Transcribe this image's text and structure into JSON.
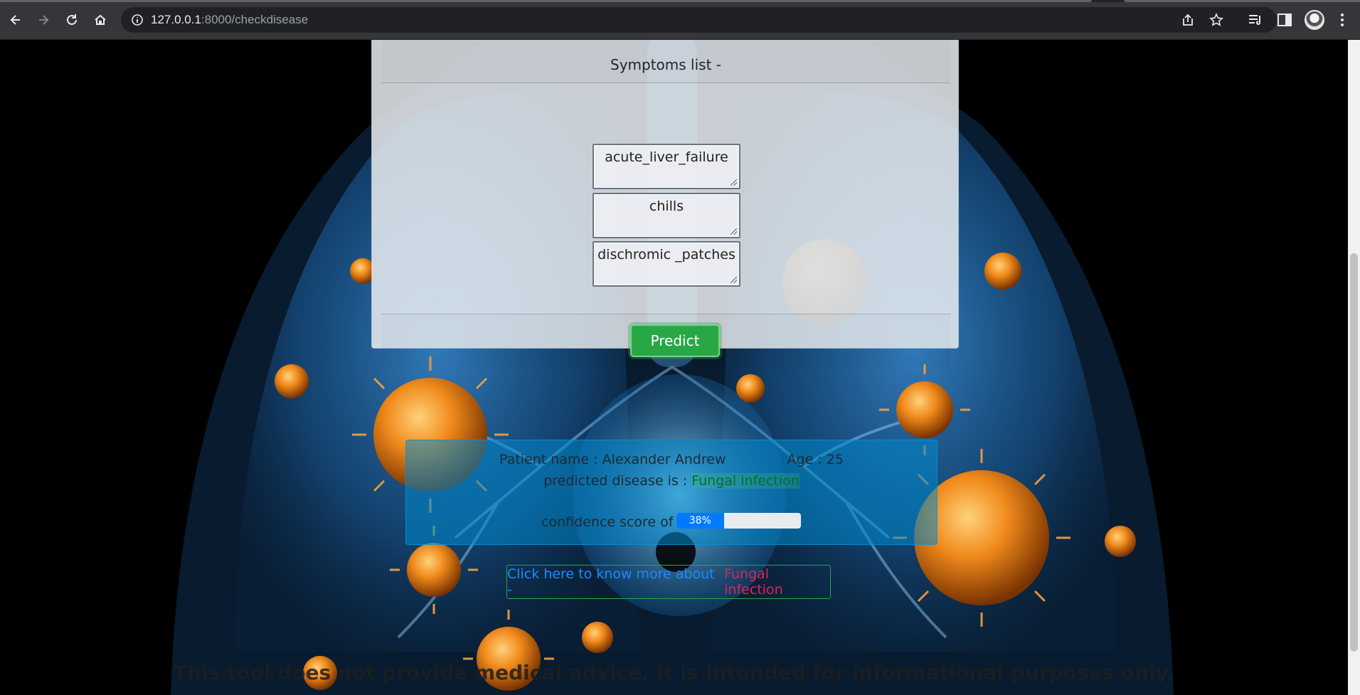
{
  "browser": {
    "url_host": "127.0.0.1",
    "url_path": ":8000/checkdisease"
  },
  "card": {
    "header": "Symptoms list -",
    "symptoms": [
      "acute_liver_failure",
      "chills",
      "dischromic _patches"
    ],
    "predict_label": "Predict"
  },
  "result": {
    "patient_label": "Patient name : Alexander Andrew",
    "age_label": "Age : 25",
    "predicted_prefix": "predicted disease is :",
    "disease": "Fungal infection",
    "confidence_label": "confidence score of :",
    "confidence_percent": 38,
    "confidence_text": "38%"
  },
  "learn_more": {
    "lead": "Click here to know more about -",
    "disease": "Fungal infection"
  },
  "disclaimer": "This tool does not provide medical advice, It is intended for informational purposes only.",
  "colors": {
    "predict": "#28a745",
    "progress": "#007bff",
    "result_bg": "#0088cc",
    "link": "#1a8cff",
    "disease_link": "#e0245e"
  }
}
